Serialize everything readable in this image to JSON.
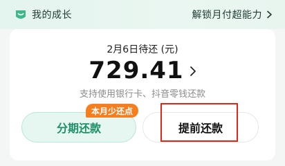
{
  "header": {
    "growth_label": "我的成长",
    "unlock_label": "解锁月付超能力",
    "growth_icon": "growth-badge-icon",
    "unlock_icon": "chevron-right-icon"
  },
  "bill": {
    "due_date": "2月6日待还 (元)",
    "amount": "729.41",
    "support_text": "支持使用银行卡、抖音零钱还款"
  },
  "actions": {
    "installment_label": "分期还款",
    "installment_badge": "本月少还点",
    "prepay_label": "提前还款"
  },
  "colors": {
    "accent_green": "#1d8f67",
    "badge_orange": "#f57f1f",
    "highlight_red": "#e0251b"
  }
}
